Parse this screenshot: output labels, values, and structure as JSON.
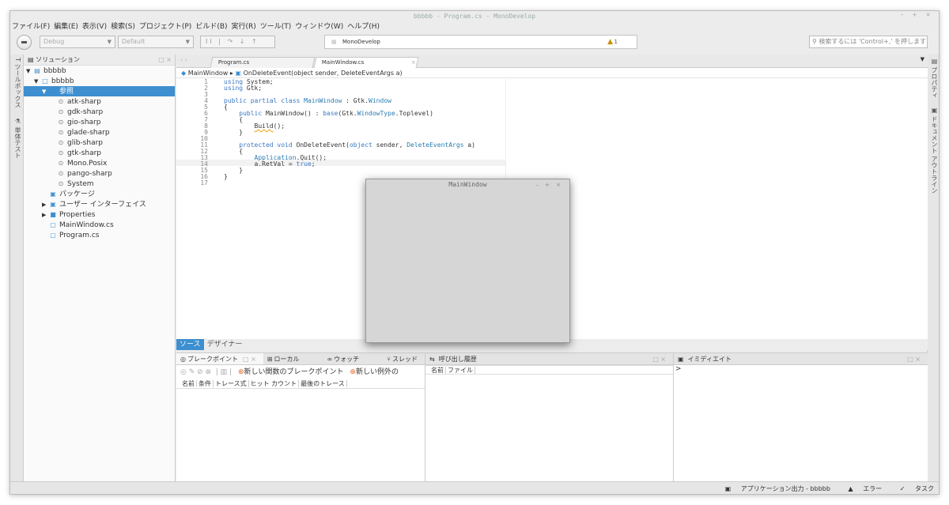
{
  "window": {
    "title": "bbbbb - Program.cs - MonoDevelop",
    "controls": "– + ×"
  },
  "menu": [
    "ファイル(F)",
    "編集(E)",
    "表示(V)",
    "検索(S)",
    "プロジェクト(P)",
    "ビルド(B)",
    "実行(R)",
    "ツール(T)",
    "ウィンドウ(W)",
    "ヘルプ(H)"
  ],
  "toolbar": {
    "config": "Debug",
    "platform": "Default",
    "debug_controls": "II | ↷ ↓ ↑",
    "status_text": "MonoDevelop",
    "warning_count": "1",
    "search_placeholder": "検索するには 'Control+,' を押します"
  },
  "left_strip": {
    "toolbox": "ツールボックス",
    "unittest": "単体テスト"
  },
  "right_strip": {
    "properties": "プロパティ",
    "outline": "ドキュメント アウトライン"
  },
  "solution": {
    "title": "ソリューション",
    "close": "□ ×",
    "items": [
      {
        "label": "bbbbb",
        "indent": 0,
        "tri": "▼",
        "icon": "▤"
      },
      {
        "label": "bbbbb",
        "indent": 1,
        "tri": "▼",
        "icon": "□"
      },
      {
        "label": "参照",
        "indent": 2,
        "tri": "▼",
        "icon": "▣",
        "selected": true
      },
      {
        "label": "atk-sharp",
        "indent": 3,
        "tri": "",
        "icon": "⊙"
      },
      {
        "label": "gdk-sharp",
        "indent": 3,
        "tri": "",
        "icon": "⊙"
      },
      {
        "label": "gio-sharp",
        "indent": 3,
        "tri": "",
        "icon": "⊙"
      },
      {
        "label": "glade-sharp",
        "indent": 3,
        "tri": "",
        "icon": "⊙"
      },
      {
        "label": "glib-sharp",
        "indent": 3,
        "tri": "",
        "icon": "⊙"
      },
      {
        "label": "gtk-sharp",
        "indent": 3,
        "tri": "",
        "icon": "⊙"
      },
      {
        "label": "Mono.Posix",
        "indent": 3,
        "tri": "",
        "icon": "⊙"
      },
      {
        "label": "pango-sharp",
        "indent": 3,
        "tri": "",
        "icon": "⊙"
      },
      {
        "label": "System",
        "indent": 3,
        "tri": "",
        "icon": "⊙"
      },
      {
        "label": "パッケージ",
        "indent": 2,
        "tri": "",
        "icon": "▣"
      },
      {
        "label": "ユーザー インターフェイス",
        "indent": 2,
        "tri": "▶",
        "icon": "▣"
      },
      {
        "label": "Properties",
        "indent": 2,
        "tri": "▶",
        "icon": "■"
      },
      {
        "label": "MainWindow.cs",
        "indent": 2,
        "tri": "",
        "icon": "▢"
      },
      {
        "label": "Program.cs",
        "indent": 2,
        "tri": "",
        "icon": "▢"
      }
    ]
  },
  "editor": {
    "tabs": [
      {
        "label": "Program.cs",
        "active": false
      },
      {
        "label": "MainWindow.cs",
        "active": true
      }
    ],
    "breadcrumb_class": "MainWindow",
    "breadcrumb_sep": "▸",
    "breadcrumb_method": "OnDeleteEvent(object sender, DeleteEventArgs a)",
    "line_numbers": [
      "1",
      "2",
      "3",
      "4",
      "5",
      "6",
      "7",
      "8",
      "9",
      "10",
      "11",
      "12",
      "13",
      "14",
      "15",
      "16",
      "17"
    ]
  },
  "floating_window": {
    "title": "MainWindow",
    "controls": "– + ×"
  },
  "view_tabs": {
    "source": "ソース",
    "designer": "デザイナー"
  },
  "breakpoints_pane": {
    "tabs": [
      "ブレークポイント",
      "ローカル",
      "ウォッチ",
      "スレッド"
    ],
    "new_function_bp": "新しい関数のブレークポイント",
    "new_exception_bp": "新しい例外の",
    "columns": [
      "名前",
      "条件",
      "トレース式",
      "ヒット カウント",
      "最後のトレース"
    ]
  },
  "callstack_pane": {
    "title": "呼び出し履歴",
    "columns": [
      "名前",
      "ファイル"
    ]
  },
  "immediate_pane": {
    "title": "イミディエイト",
    "prompt": ">"
  },
  "statusbar": {
    "app_output": "アプリケーション出力 - bbbbb",
    "errors": "エラー",
    "tasks": "タスク"
  }
}
